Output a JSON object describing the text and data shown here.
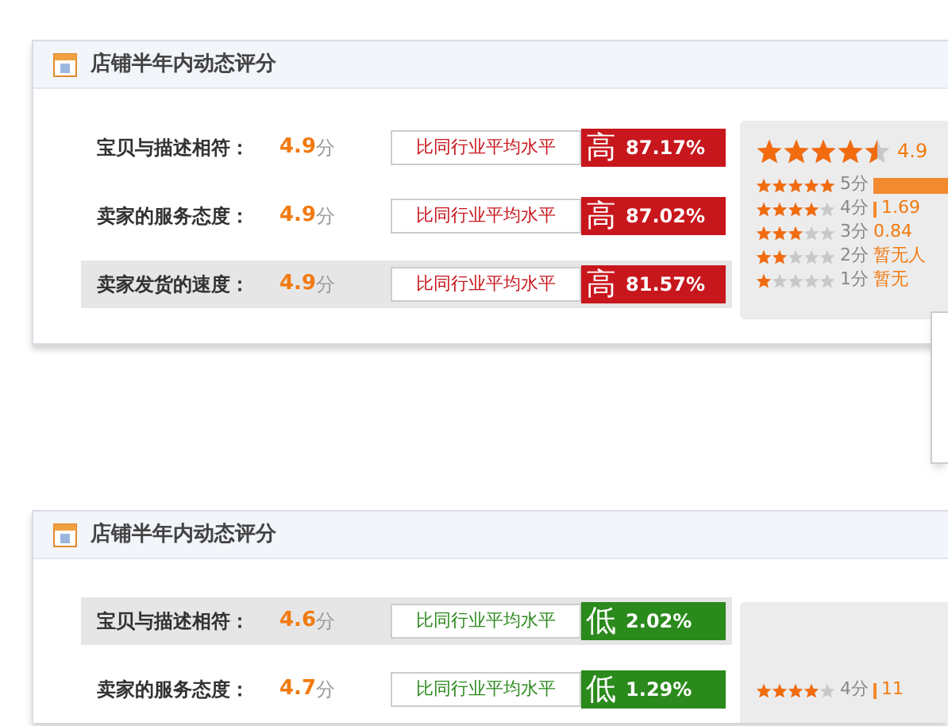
{
  "panels": [
    {
      "title": "店铺半年内动态评分",
      "rows": [
        {
          "label": "宝贝与描述相符：",
          "score": "4.9",
          "unit": "分",
          "compare": "比同行业平均水平",
          "trend_text": "高",
          "percent": "87.17%",
          "kind": "high",
          "selected": false
        },
        {
          "label": "卖家的服务态度：",
          "score": "4.9",
          "unit": "分",
          "compare": "比同行业平均水平",
          "trend_text": "高",
          "percent": "87.02%",
          "kind": "high",
          "selected": false
        },
        {
          "label": "卖家发货的速度：",
          "score": "4.9",
          "unit": "分",
          "compare": "比同行业平均水平",
          "trend_text": "高",
          "percent": "81.57%",
          "kind": "high",
          "selected": true
        }
      ],
      "summary": {
        "stars": 4.5,
        "score": "4.9",
        "breakdown": [
          {
            "stars": 5,
            "label": "5分",
            "kind": "long"
          },
          {
            "stars": 4,
            "label": "4分",
            "kind": "tick",
            "text": "1.69"
          },
          {
            "stars": 3,
            "label": "3分",
            "text": "0.84"
          },
          {
            "stars": 2,
            "label": "2分",
            "text": "暂无人"
          },
          {
            "stars": 1,
            "label": "1分",
            "text": "暂无"
          }
        ]
      }
    },
    {
      "title": "店铺半年内动态评分",
      "rows": [
        {
          "label": "宝贝与描述相符：",
          "score": "4.6",
          "unit": "分",
          "compare": "比同行业平均水平",
          "trend_text": "低",
          "percent": "2.02%",
          "kind": "low",
          "selected": true
        },
        {
          "label": "卖家的服务态度：",
          "score": "4.7",
          "unit": "分",
          "compare": "比同行业平均水平",
          "trend_text": "低",
          "percent": "1.29%",
          "kind": "low",
          "selected": false
        }
      ],
      "summary": {
        "breakdown": [
          {
            "stars": 4,
            "label": "4分",
            "kind": "tick",
            "text": "11"
          }
        ]
      }
    }
  ]
}
